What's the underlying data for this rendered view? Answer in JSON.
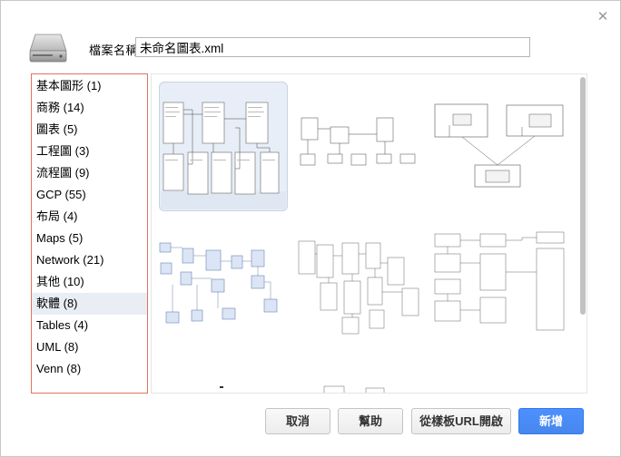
{
  "dialog": {
    "filename_label": "檔案名稱:",
    "filename_value": "未命名圖表.xml"
  },
  "categories": [
    {
      "label": "基本圖形 (1)"
    },
    {
      "label": "商務 (14)"
    },
    {
      "label": "圖表 (5)"
    },
    {
      "label": "工程圖 (3)"
    },
    {
      "label": "流程圖 (9)"
    },
    {
      "label": "GCP (55)"
    },
    {
      "label": "布局 (4)"
    },
    {
      "label": "Maps (5)"
    },
    {
      "label": "Network (21)"
    },
    {
      "label": "其他 (10)"
    },
    {
      "label": "軟體 (8)"
    },
    {
      "label": "Tables (4)"
    },
    {
      "label": "UML (8)"
    },
    {
      "label": "Venn (8)"
    }
  ],
  "selected_category": "軟體 (8)",
  "buttons": {
    "cancel": "取消",
    "help": "幫助",
    "from_template_url": "從樣板URL開啟",
    "create": "新增"
  },
  "colors": {
    "accent": "#4d90fe",
    "list_border": "#e0735f",
    "selected_bg": "#e9eef5"
  }
}
